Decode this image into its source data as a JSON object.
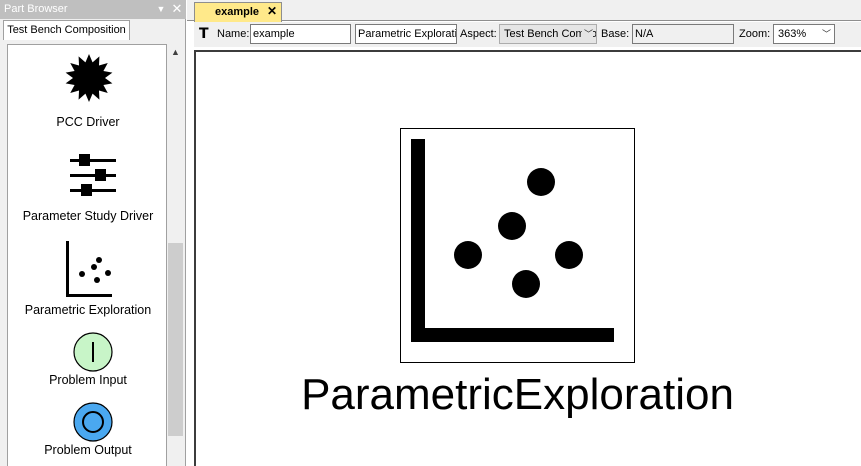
{
  "part_browser": {
    "title": "Part Browser",
    "pin_icon": "dropdown-arrow-icon",
    "close_icon": "close-icon",
    "tab_label": "Test Bench Composition",
    "parts": [
      {
        "label": "PCC Driver",
        "icon": "starburst-icon"
      },
      {
        "label": "Parameter Study Driver",
        "icon": "sliders-icon"
      },
      {
        "label": "Parametric Exploration",
        "icon": "scatter-plot-icon"
      },
      {
        "label": "Problem Input",
        "icon": "problem-input-icon",
        "color": "#c8f5c8"
      },
      {
        "label": "Problem Output",
        "icon": "problem-output-icon",
        "color": "#4aa8f0"
      }
    ]
  },
  "editor": {
    "tab": {
      "label": "example",
      "color": "#ffe98a"
    },
    "toolbar": {
      "name_label": "Name:",
      "name_value": "example",
      "kind_value": "Parametric Exploration",
      "aspect_label": "Aspect:",
      "aspect_value": "Test Bench Composition",
      "base_label": "Base:",
      "base_value": "N/A",
      "zoom_label": "Zoom:",
      "zoom_value": "363%"
    },
    "canvas": {
      "element_label": "ParametricExploration",
      "element_icon": "scatter-plot-icon"
    }
  }
}
